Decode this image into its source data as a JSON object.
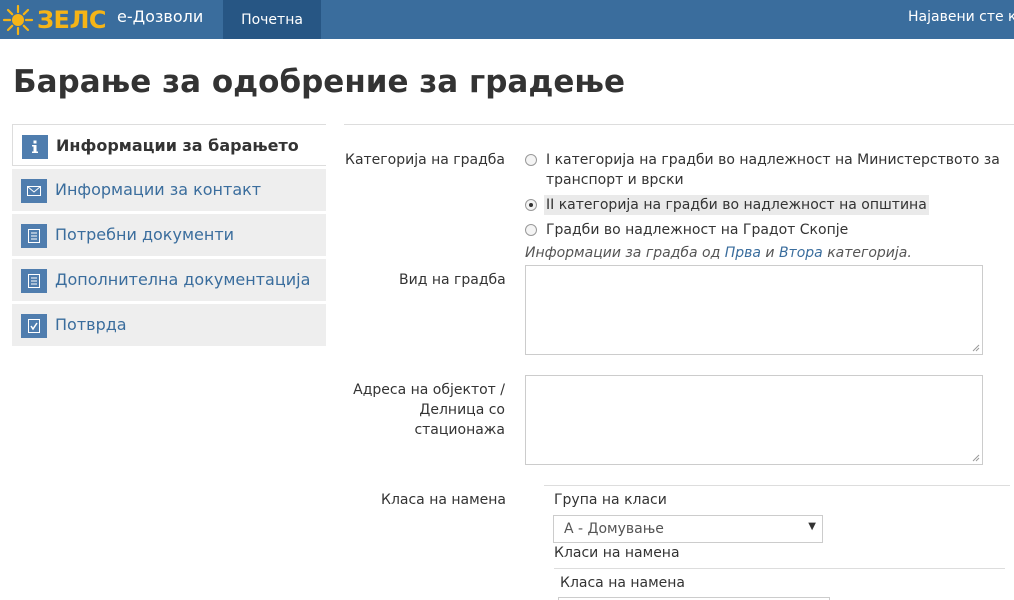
{
  "navbar": {
    "logo_text": "ЗЕЛС",
    "app_name": "е-Дозволи",
    "home_label": "Почетна",
    "login_label": "Најавени сте к"
  },
  "page": {
    "title": "Барање за одобрение за градење"
  },
  "sidebar": {
    "items": [
      {
        "label": "Информации за барањето",
        "icon": "info-icon",
        "active": true
      },
      {
        "label": "Информации за контакт",
        "icon": "envelope-icon",
        "active": false
      },
      {
        "label": "Потребни документи",
        "icon": "document-icon",
        "active": false
      },
      {
        "label": "Дополнителна документација",
        "icon": "document-icon",
        "active": false
      },
      {
        "label": "Потврда",
        "icon": "check-document-icon",
        "active": false
      }
    ]
  },
  "form": {
    "category": {
      "label": "Категорија на градба",
      "options": [
        {
          "line1": "I категорија на градби во надлежност на Министерството за",
          "line2": "транспорт и врски",
          "checked": false
        },
        {
          "line1": "II категорија на градби во надлежност на општина",
          "checked": true
        },
        {
          "line1": "Градби во надлежност на Градот Скопје",
          "checked": false
        }
      ],
      "help_prefix": "Информации за градба од ",
      "help_link1": "Прва",
      "help_mid": " и ",
      "help_link2": "Втора",
      "help_suffix": " категорија."
    },
    "type": {
      "label": "Вид на градба",
      "value": ""
    },
    "address": {
      "label_line1": "Адреса на објектот /",
      "label_line2": "Делница со",
      "label_line3": "стационажа",
      "value": ""
    },
    "purpose": {
      "label": "Класа на намена",
      "group_label": "Група на класи",
      "group_value": "А - Домување",
      "classes_label": "Класи на намена",
      "class_label": "Класа на намена"
    }
  },
  "colors": {
    "navbar": "#3a6d9d",
    "navbar_active": "#275684",
    "logo": "#f5b417",
    "link": "#3a6d9d"
  }
}
